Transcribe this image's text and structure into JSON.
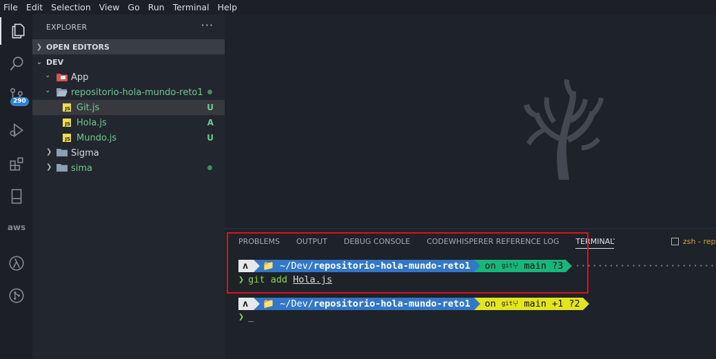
{
  "menu": [
    "File",
    "Edit",
    "Selection",
    "View",
    "Go",
    "Run",
    "Terminal",
    "Help"
  ],
  "activity_bar": {
    "scm_badge": "290",
    "aws_label": "aws"
  },
  "sidebar": {
    "title": "EXPLORER",
    "more": "···",
    "sections": {
      "open_editors": "OPEN EDITORS",
      "workspace": "DEV"
    },
    "tree": [
      {
        "label": "App",
        "type": "folder-app",
        "expanded": true,
        "color": "#d6dbe2"
      },
      {
        "label": "repositorio-hola-mundo-reto1",
        "type": "folder-open",
        "expanded": true,
        "color": "#73c991"
      },
      {
        "label": "Git.js",
        "type": "js-file",
        "status": "U",
        "selected": true
      },
      {
        "label": "Hola.js",
        "type": "js-file",
        "status": "A"
      },
      {
        "label": "Mundo.js",
        "type": "js-file",
        "status": "U"
      },
      {
        "label": "Sigma",
        "type": "folder",
        "expanded": false,
        "color": "#d6dbe2"
      },
      {
        "label": "sima",
        "type": "folder",
        "expanded": false,
        "color": "#73c991"
      }
    ]
  },
  "panel": {
    "tabs": [
      "PROBLEMS",
      "OUTPUT",
      "DEBUG CONSOLE",
      "CODEWHISPERER REFERENCE LOG",
      "TERMINAL"
    ],
    "active_tab": "TERMINAL",
    "more": "···",
    "terminal_label": "zsh - repo"
  },
  "terminal": {
    "prompt1": {
      "os_icon": "ʌ",
      "dir_prefix": "📁 ~/Dev/",
      "dir_name": "repositorio-hola-mundo-reto1",
      "git_on": "on",
      "git_icon": "git",
      "branch_icon": "⑂",
      "branch": "main",
      "git_status": "?3",
      "git_color": "#17b67b"
    },
    "command1": {
      "caret": "❯",
      "text": "git add ",
      "arg": "Hola.js"
    },
    "prompt2": {
      "os_icon": "ʌ",
      "dir_prefix": "📁 ~/Dev/",
      "dir_name": "repositorio-hola-mundo-reto1",
      "git_on": "on",
      "git_icon": "git",
      "branch_icon": "⑂",
      "branch": "main",
      "git_status": "+1 ?2",
      "git_color": "#e3e51e"
    },
    "command2": {
      "caret": "❯",
      "cursor": "_"
    }
  },
  "colors": {
    "accent_badge": "#2f81d4",
    "git_added": "#73c991",
    "highlight_box": "#e0121d"
  }
}
